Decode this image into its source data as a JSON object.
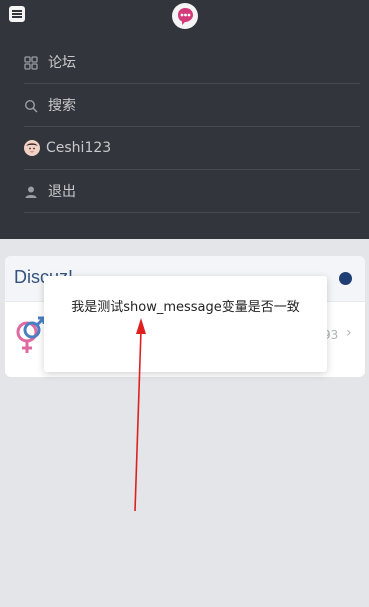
{
  "header": {
    "menu_icon": "hamburger-menu-icon",
    "logo_icon": "site-logo-chat-bubble"
  },
  "menu": {
    "items": [
      {
        "label": "论坛",
        "icon": "grid-icon"
      },
      {
        "label": "搜索",
        "icon": "search-icon"
      },
      {
        "label": "Ceshi123",
        "icon": "avatar"
      },
      {
        "label": "退出",
        "icon": "user-icon"
      }
    ]
  },
  "forum_card": {
    "title": "Discuz!",
    "count": "93",
    "forum_icon": "gender-symbols-icon",
    "accent_color": "#1f3f74"
  },
  "toast": {
    "message": "我是测试show_message变量是否一致"
  },
  "colors": {
    "menu_bg": "#32353b",
    "page_bg": "#e3e5e9",
    "annotation_arrow": "#e02020"
  }
}
